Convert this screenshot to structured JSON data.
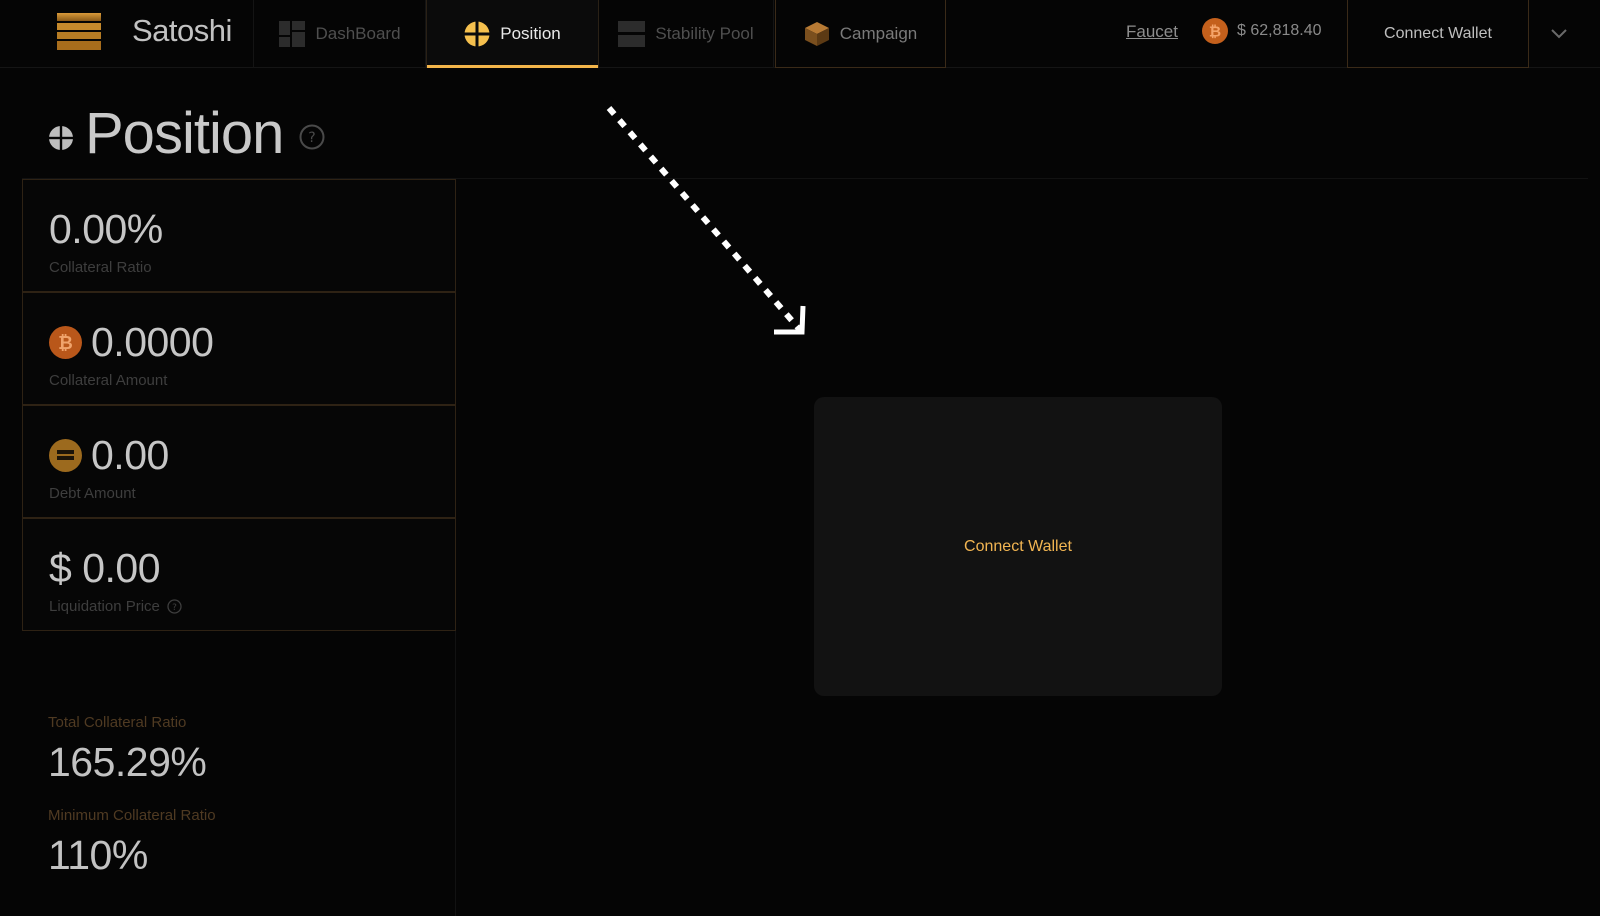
{
  "brand": {
    "name": "Satoshi"
  },
  "nav": {
    "tabs": [
      {
        "label": "DashBoard"
      },
      {
        "label": "Position"
      },
      {
        "label": "Stability Pool"
      },
      {
        "label": "Campaign"
      }
    ],
    "active": "Position"
  },
  "header": {
    "faucet_label": "Faucet",
    "btc_price": "$ 62,818.40",
    "connect_label": "Connect Wallet"
  },
  "page": {
    "title": "Position"
  },
  "stats": [
    {
      "value": "0.00%",
      "label": "Collateral Ratio"
    },
    {
      "value": "0.0000",
      "label": "Collateral Amount"
    },
    {
      "value": "0.00",
      "label": "Debt Amount"
    },
    {
      "value": "$ 0.00",
      "label": "Liquidation Price"
    }
  ],
  "summary": {
    "total_label": "Total Collateral Ratio",
    "total_value": "165.29%",
    "min_label": "Minimum Collateral Ratio",
    "min_value": "110%"
  },
  "main": {
    "connect_label": "Connect Wallet"
  },
  "colors": {
    "accent": "#f3b54a",
    "bitcoin": "#c4601c",
    "background": "#050505",
    "card": "#121212",
    "border": "#2e2214"
  }
}
